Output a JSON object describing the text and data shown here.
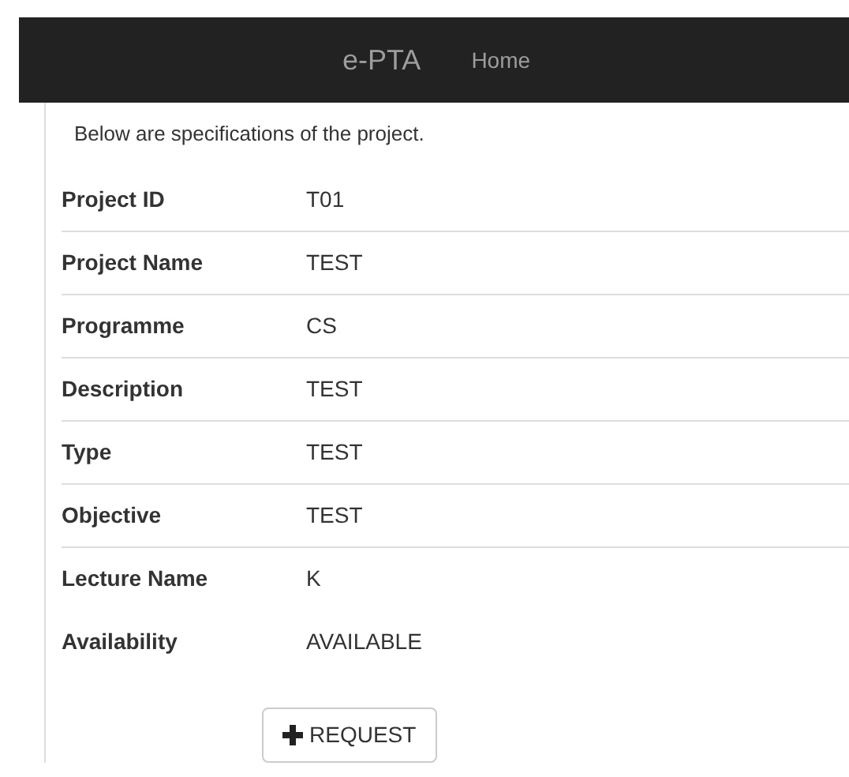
{
  "navbar": {
    "brand": "e-PTA",
    "links": [
      "Home"
    ]
  },
  "intro": "Below are specifications of the project.",
  "specs": [
    {
      "label": "Project ID",
      "value": "T01"
    },
    {
      "label": "Project Name",
      "value": "TEST"
    },
    {
      "label": "Programme",
      "value": "CS"
    },
    {
      "label": "Description",
      "value": "TEST"
    },
    {
      "label": "Type",
      "value": "TEST"
    },
    {
      "label": "Objective",
      "value": "TEST"
    },
    {
      "label": "Lecture Name",
      "value": "K"
    },
    {
      "label": "Availability",
      "value": "AVAILABLE"
    }
  ],
  "request_button": "REQUEST"
}
